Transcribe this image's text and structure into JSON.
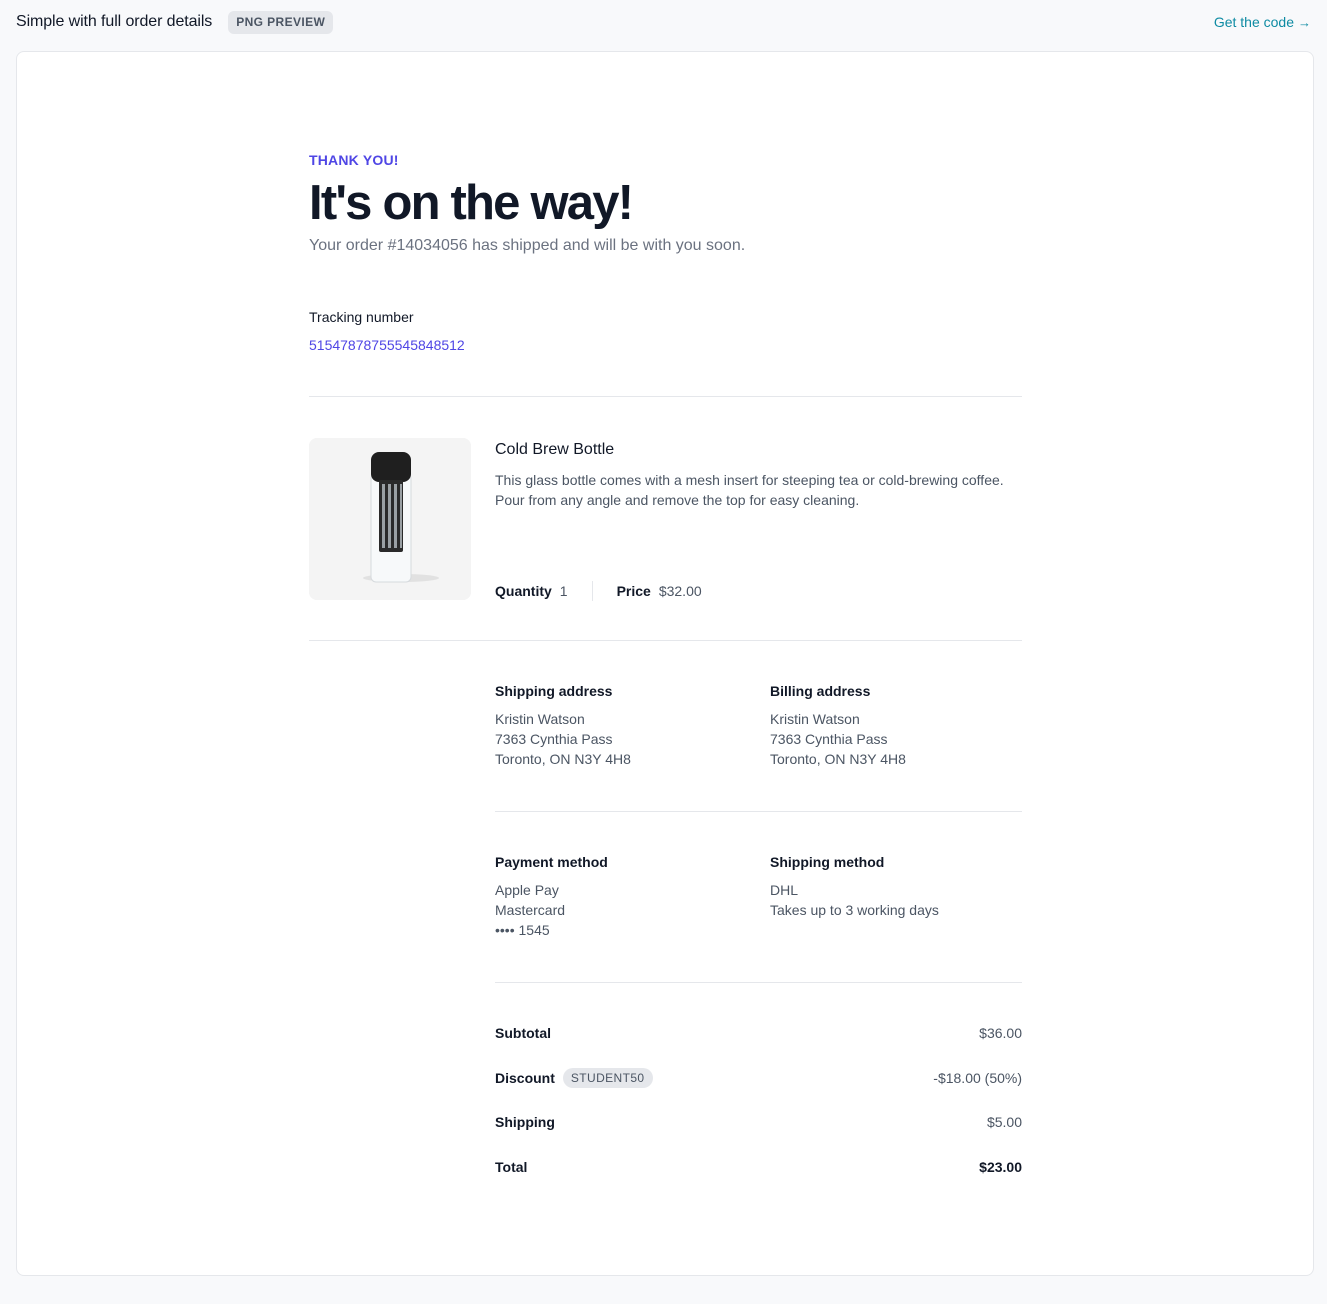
{
  "header": {
    "title": "Simple with full order details",
    "badge": "PNG PREVIEW",
    "get_code": "Get the code",
    "get_code_arrow": "→"
  },
  "order": {
    "eyebrow": "THANK YOU!",
    "heading": "It's on the way!",
    "subtitle": "Your order #14034056 has shipped and will be with you soon.",
    "tracking_label": "Tracking number",
    "tracking_number": "51547878755545848512"
  },
  "product": {
    "name": "Cold Brew Bottle",
    "description": "This glass bottle comes with a mesh insert for steeping tea or cold-brewing coffee. Pour from any angle and remove the top for easy cleaning.",
    "quantity_label": "Quantity",
    "quantity": "1",
    "price_label": "Price",
    "price": "$32.00"
  },
  "shipping_address": {
    "title": "Shipping address",
    "lines": [
      "Kristin Watson",
      "7363 Cynthia Pass",
      "Toronto, ON N3Y 4H8"
    ]
  },
  "billing_address": {
    "title": "Billing address",
    "lines": [
      "Kristin Watson",
      "7363 Cynthia Pass",
      "Toronto, ON N3Y 4H8"
    ]
  },
  "payment_method": {
    "title": "Payment method",
    "lines": [
      "Apple Pay",
      "Mastercard",
      "•••• 1545"
    ]
  },
  "shipping_method": {
    "title": "Shipping method",
    "lines": [
      "DHL",
      "Takes up to 3 working days"
    ]
  },
  "summary": {
    "subtotal_label": "Subtotal",
    "subtotal": "$36.00",
    "discount_label": "Discount",
    "discount_code": "STUDENT50",
    "discount": "-$18.00 (50%)",
    "shipping_label": "Shipping",
    "shipping": "$5.00",
    "total_label": "Total",
    "total": "$23.00"
  },
  "colors": {
    "accent": "#4f46e5",
    "link": "#0e8ba3",
    "text": "#111827",
    "muted": "#6b7280"
  }
}
